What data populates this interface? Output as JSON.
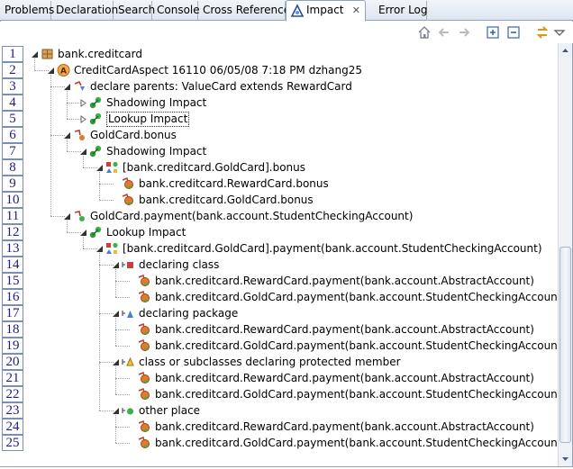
{
  "tabs": [
    {
      "label": "Problems"
    },
    {
      "label": "Declaration"
    },
    {
      "label": "Search"
    },
    {
      "label": "Console"
    },
    {
      "label": "Cross References"
    },
    {
      "label": "Impact",
      "active": true
    },
    {
      "label": "Error Log"
    }
  ],
  "toolbar": {
    "icons": [
      "home-icon",
      "back-arrow-icon",
      "forward-arrow-icon",
      "expand-all-icon",
      "collapse-all-icon",
      "sync-icon",
      "view-menu-icon"
    ]
  },
  "tree": {
    "rows": [
      {
        "line": "1",
        "label": "bank.creditcard",
        "icon": "package-icon",
        "expanded": true
      },
      {
        "line": "2",
        "label": "CreditCardAspect 16110  06/05/08 7:18 PM  dzhang25",
        "icon": "aspect-icon",
        "expanded": true
      },
      {
        "line": "3",
        "label": "declare parents: ValueCard extends RewardCard",
        "icon": "declare-parents-icon",
        "expanded": true
      },
      {
        "line": "4",
        "label": "Shadowing Impact",
        "icon": "impact-icon",
        "expanded": false
      },
      {
        "line": "5",
        "label": "Lookup Impact",
        "icon": "impact-icon",
        "expanded": false,
        "selected": true
      },
      {
        "line": "6",
        "label": "GoldCard.bonus",
        "icon": "field-change-icon",
        "expanded": true
      },
      {
        "line": "7",
        "label": "Shadowing Impact",
        "icon": "impact-icon",
        "expanded": true
      },
      {
        "line": "8",
        "label": "[bank.creditcard.GoldCard].bonus",
        "icon": "shapes-icon",
        "expanded": true
      },
      {
        "line": "9",
        "label": "bank.creditcard.RewardCard.bonus",
        "icon": "reference-icon"
      },
      {
        "line": "10",
        "label": "bank.creditcard.GoldCard.bonus",
        "icon": "reference-icon"
      },
      {
        "line": "11",
        "label": "GoldCard.payment(bank.account.StudentCheckingAccount)",
        "icon": "method-change-icon",
        "expanded": true
      },
      {
        "line": "12",
        "label": "Lookup Impact",
        "icon": "impact-icon",
        "expanded": true
      },
      {
        "line": "13",
        "label": "[bank.creditcard.GoldCard].payment(bank.account.StudentCheckingAccount)",
        "icon": "shapes-icon",
        "expanded": true
      },
      {
        "line": "14",
        "label": "declaring class",
        "icon": "declaring-class-icon",
        "expanded": true
      },
      {
        "line": "15",
        "label": "bank.creditcard.RewardCard.payment(bank.account.AbstractAccount)",
        "icon": "reference-icon"
      },
      {
        "line": "16",
        "label": "bank.creditcard.GoldCard.payment(bank.account.StudentCheckingAccount)",
        "icon": "reference-icon"
      },
      {
        "line": "17",
        "label": "declaring package",
        "icon": "declaring-package-icon",
        "expanded": true
      },
      {
        "line": "18",
        "label": "bank.creditcard.RewardCard.payment(bank.account.AbstractAccount)",
        "icon": "reference-icon"
      },
      {
        "line": "19",
        "label": "bank.creditcard.GoldCard.payment(bank.account.StudentCheckingAccount)",
        "icon": "reference-icon"
      },
      {
        "line": "20",
        "label": "class or subclasses declaring protected member",
        "icon": "protected-member-icon",
        "expanded": true
      },
      {
        "line": "21",
        "label": "bank.creditcard.RewardCard.payment(bank.account.AbstractAccount)",
        "icon": "reference-icon"
      },
      {
        "line": "22",
        "label": "bank.creditcard.GoldCard.payment(bank.account.StudentCheckingAccount)",
        "icon": "reference-icon"
      },
      {
        "line": "23",
        "label": "other place",
        "icon": "other-place-icon",
        "expanded": true
      },
      {
        "line": "24",
        "label": "bank.creditcard.RewardCard.payment(bank.account.AbstractAccount)",
        "icon": "reference-icon"
      },
      {
        "line": "25",
        "label": "bank.creditcard.GoldCard.payment(bank.account.StudentCheckingAccount)",
        "icon": "reference-icon"
      }
    ]
  },
  "colors": {
    "frame_border": "#8fa3c0",
    "line_number": "#1b1b8c"
  }
}
